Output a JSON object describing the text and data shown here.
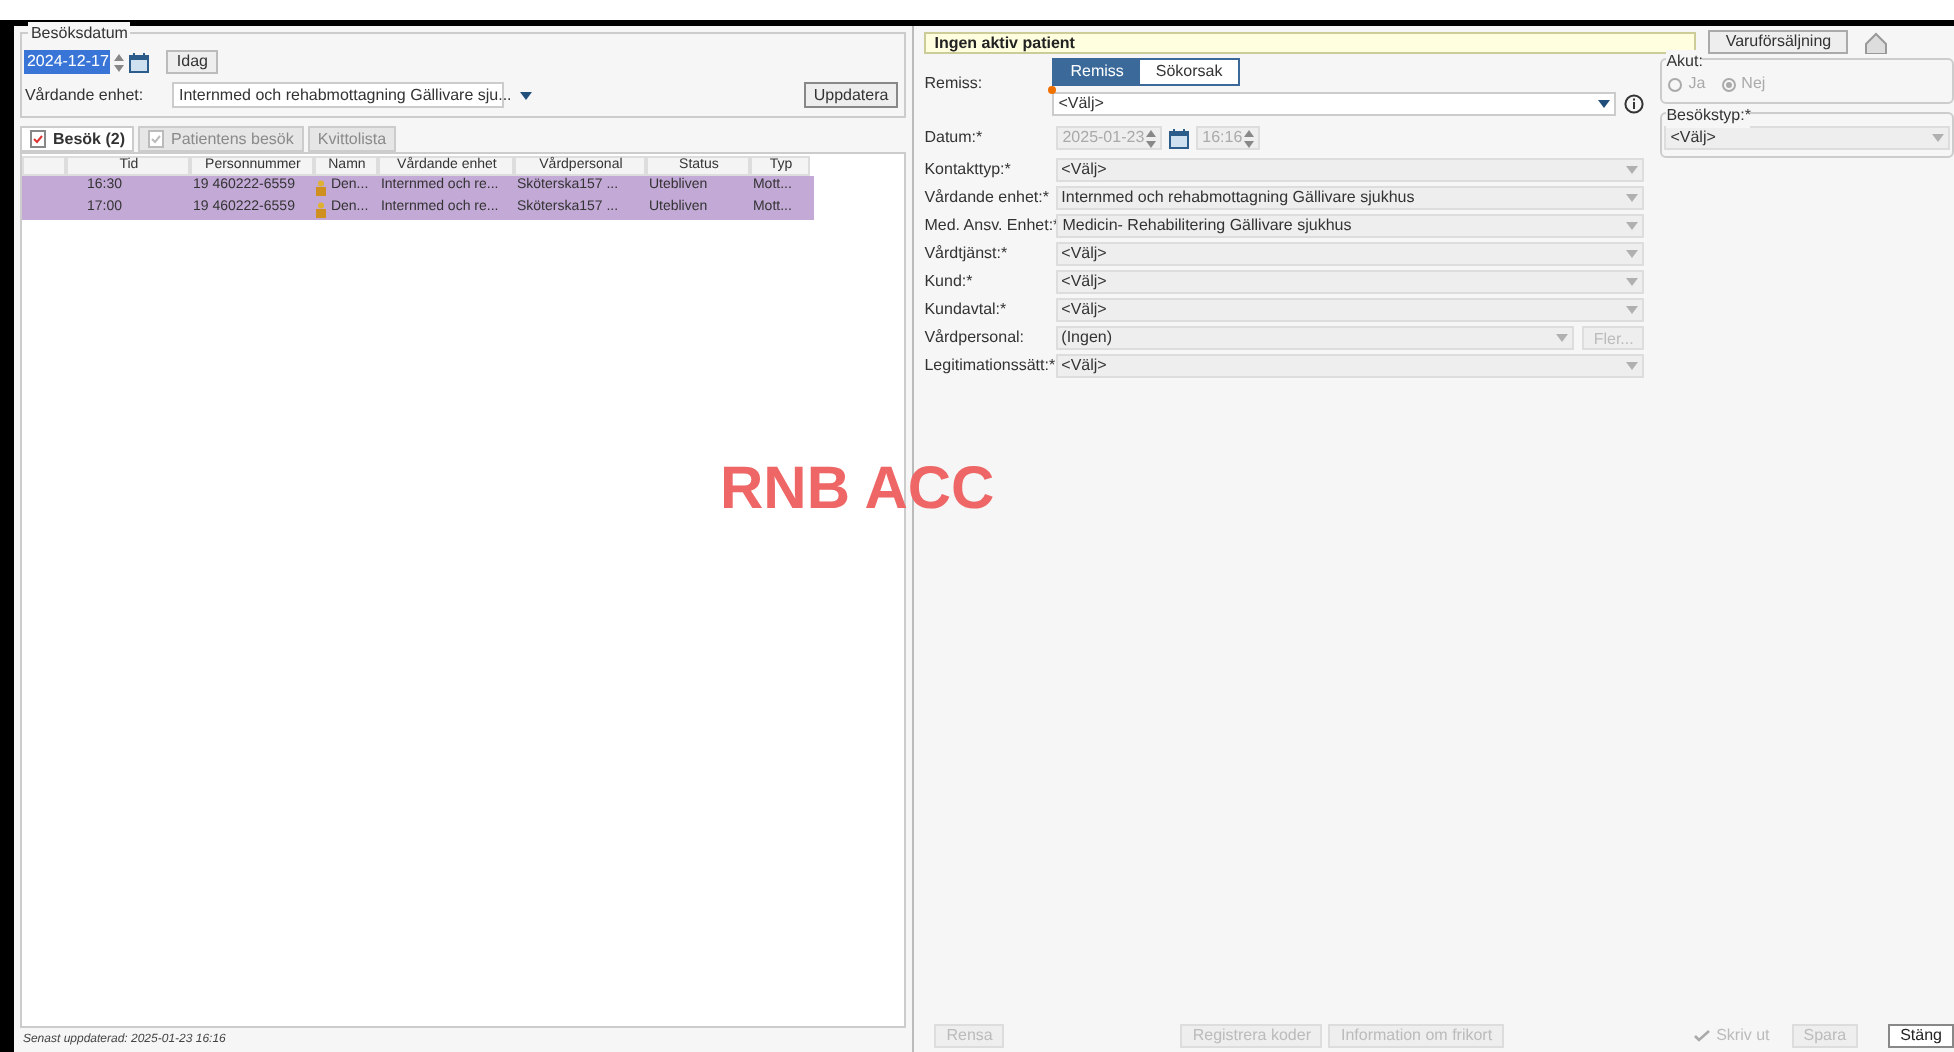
{
  "visit_date": {
    "legend": "Besöksdatum",
    "date": "2024-12-17",
    "today_button": "Idag"
  },
  "unit": {
    "label": "Vårdande enhet:",
    "value": "Internmed och rehabmottagning Gällivare sju...",
    "update_button": "Uppdatera"
  },
  "tabs": [
    {
      "label": "Besök (2)",
      "selected": true,
      "disabled": false
    },
    {
      "label": "Patientens besök",
      "selected": false,
      "disabled": true
    },
    {
      "label": "Kvittolista",
      "selected": false,
      "disabled": true
    }
  ],
  "table": {
    "columns": [
      "Tid",
      "Personnummer",
      "Namn",
      "Vårdande enhet",
      "Vårdpersonal",
      "Status",
      "Typ"
    ],
    "rows": [
      {
        "selected": true,
        "cells": [
          "16:30",
          "19 460222-6559",
          "Den...",
          "Internmed och re...",
          "Sköterska157 ...",
          "Utebliven",
          "Mott..."
        ]
      },
      {
        "selected": true,
        "cells": [
          "17:00",
          "19 460222-6559",
          "Den...",
          "Internmed och re...",
          "Sköterska157 ...",
          "Utebliven",
          "Mott..."
        ]
      }
    ]
  },
  "status_bar": "Senast uppdaterad: 2025-01-23 16:16",
  "environment_label": "RNB ACC",
  "patient_banner": "Ingen aktiv patient",
  "sales_button": "Varuförsäljning",
  "remiss": {
    "label": "Remiss:",
    "toggle": [
      {
        "label": "Remiss",
        "selected": true
      },
      {
        "label": "Sökorsak",
        "selected": false
      }
    ],
    "value": "<Välj>"
  },
  "date": {
    "label": "Datum:*",
    "date": "2025-01-23",
    "time": "16:16"
  },
  "fields": [
    {
      "label": "Kontakttyp:*",
      "value": "<Välj>"
    },
    {
      "label": "Vårdande enhet:*",
      "value": "Internmed och rehabmottagning Gällivare sjukhus"
    },
    {
      "label": "Med. Ansv. Enhet:*",
      "value": "Medicin- Rehabilitering Gällivare sjukhus"
    },
    {
      "label": "Vårdtjänst:*",
      "value": "<Välj>"
    },
    {
      "label": "Kund:*",
      "value": "<Välj>"
    },
    {
      "label": "Kundavtal:*",
      "value": "<Välj>"
    },
    {
      "label": "Vårdpersonal:",
      "value": "(Ingen)",
      "extra_button": "Fler..."
    },
    {
      "label": "Legitimationssätt:*",
      "value": "<Välj>"
    }
  ],
  "acute": {
    "legend": "Akut:",
    "options": [
      {
        "label": "Ja",
        "selected": false
      },
      {
        "label": "Nej",
        "selected": true
      }
    ]
  },
  "visit_type": {
    "legend": "Besökstyp:*",
    "value": "<Välj>"
  },
  "footer_buttons": [
    {
      "label": "Rensa",
      "disabled": true
    },
    {
      "label": "Registrera koder",
      "disabled": true
    },
    {
      "label": "Information om frikort",
      "disabled": true
    },
    {
      "label": "Skriv ut",
      "disabled": true,
      "kind": "check"
    },
    {
      "label": "Spara",
      "disabled": true
    },
    {
      "label": "Stäng",
      "disabled": false
    }
  ]
}
